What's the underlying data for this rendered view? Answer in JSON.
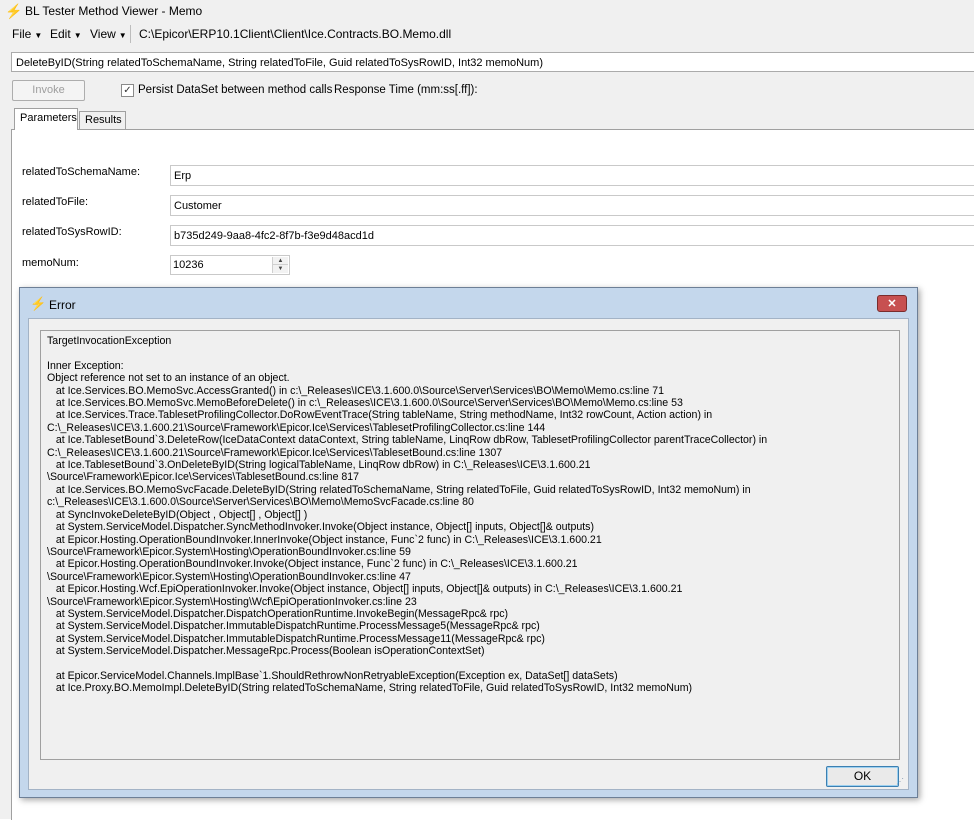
{
  "window": {
    "title": "BL Tester Method Viewer - Memo",
    "icon": "lightning-icon"
  },
  "menubar": {
    "items": [
      "File",
      "Edit",
      "View"
    ],
    "path": "C:\\Epicor\\ERP10.1Client\\Client\\Ice.Contracts.BO.Memo.dll"
  },
  "method_signature": "DeleteByID(String relatedToSchemaName, String relatedToFile, Guid relatedToSysRowID, Int32 memoNum)",
  "toolbar": {
    "invoke_label": "Invoke",
    "persist_checked": true,
    "persist_label": "Persist DataSet between method calls",
    "response_time_label": "Response Time (mm:ss[.ff]):"
  },
  "tabs": {
    "parameters": "Parameters",
    "results": "Results"
  },
  "params": [
    {
      "label": "relatedToSchemaName:",
      "value": "Erp"
    },
    {
      "label": "relatedToFile:",
      "value": "Customer"
    },
    {
      "label": "relatedToSysRowID:",
      "value": "b735d249-9aa8-4fc2-8f7b-f3e9d48acd1d"
    },
    {
      "label": "memoNum:",
      "value": "10236"
    }
  ],
  "error_dialog": {
    "title": "Error",
    "ok_label": "OK",
    "lines": [
      "TargetInvocationException",
      "",
      "Inner Exception:",
      "Object reference not set to an instance of an object.",
      "   at Ice.Services.BO.MemoSvc.AccessGranted() in c:\\_Releases\\ICE\\3.1.600.0\\Source\\Server\\Services\\BO\\Memo\\Memo.cs:line 71",
      "   at Ice.Services.BO.MemoSvc.MemoBeforeDelete() in c:\\_Releases\\ICE\\3.1.600.0\\Source\\Server\\Services\\BO\\Memo\\Memo.cs:line 53",
      "   at Ice.Services.Trace.TablesetProfilingCollector.DoRowEventTrace(String tableName, String methodName, Int32 rowCount, Action action) in",
      "C:\\_Releases\\ICE\\3.1.600.21\\Source\\Framework\\Epicor.Ice\\Services\\TablesetProfilingCollector.cs:line 144",
      "   at Ice.TablesetBound`3.DeleteRow(IceDataContext dataContext, String tableName, LinqRow dbRow, TablesetProfilingCollector parentTraceCollector) in",
      "C:\\_Releases\\ICE\\3.1.600.21\\Source\\Framework\\Epicor.Ice\\Services\\TablesetBound.cs:line 1307",
      "   at Ice.TablesetBound`3.OnDeleteByID(String logicalTableName, LinqRow dbRow) in C:\\_Releases\\ICE\\3.1.600.21",
      "\\Source\\Framework\\Epicor.Ice\\Services\\TablesetBound.cs:line 817",
      "   at Ice.Services.BO.MemoSvcFacade.DeleteByID(String relatedToSchemaName, String relatedToFile, Guid relatedToSysRowID, Int32 memoNum) in",
      "c:\\_Releases\\ICE\\3.1.600.0\\Source\\Server\\Services\\BO\\Memo\\MemoSvcFacade.cs:line 80",
      "   at SyncInvokeDeleteByID(Object , Object[] , Object[] )",
      "   at System.ServiceModel.Dispatcher.SyncMethodInvoker.Invoke(Object instance, Object[] inputs, Object[]& outputs)",
      "   at Epicor.Hosting.OperationBoundInvoker.InnerInvoke(Object instance, Func`2 func) in C:\\_Releases\\ICE\\3.1.600.21",
      "\\Source\\Framework\\Epicor.System\\Hosting\\OperationBoundInvoker.cs:line 59",
      "   at Epicor.Hosting.OperationBoundInvoker.Invoke(Object instance, Func`2 func) in C:\\_Releases\\ICE\\3.1.600.21",
      "\\Source\\Framework\\Epicor.System\\Hosting\\OperationBoundInvoker.cs:line 47",
      "   at Epicor.Hosting.Wcf.EpiOperationInvoker.Invoke(Object instance, Object[] inputs, Object[]& outputs) in C:\\_Releases\\ICE\\3.1.600.21",
      "\\Source\\Framework\\Epicor.System\\Hosting\\Wcf\\EpiOperationInvoker.cs:line 23",
      "   at System.ServiceModel.Dispatcher.DispatchOperationRuntime.InvokeBegin(MessageRpc& rpc)",
      "   at System.ServiceModel.Dispatcher.ImmutableDispatchRuntime.ProcessMessage5(MessageRpc& rpc)",
      "   at System.ServiceModel.Dispatcher.ImmutableDispatchRuntime.ProcessMessage11(MessageRpc& rpc)",
      "   at System.ServiceModel.Dispatcher.MessageRpc.Process(Boolean isOperationContextSet)",
      "",
      "   at Epicor.ServiceModel.Channels.ImplBase`1.ShouldRethrowNonRetryableException(Exception ex, DataSet[] dataSets)",
      "   at Ice.Proxy.BO.MemoImpl.DeleteByID(String relatedToSchemaName, String relatedToFile, Guid relatedToSysRowID, Int32 memoNum)"
    ]
  }
}
